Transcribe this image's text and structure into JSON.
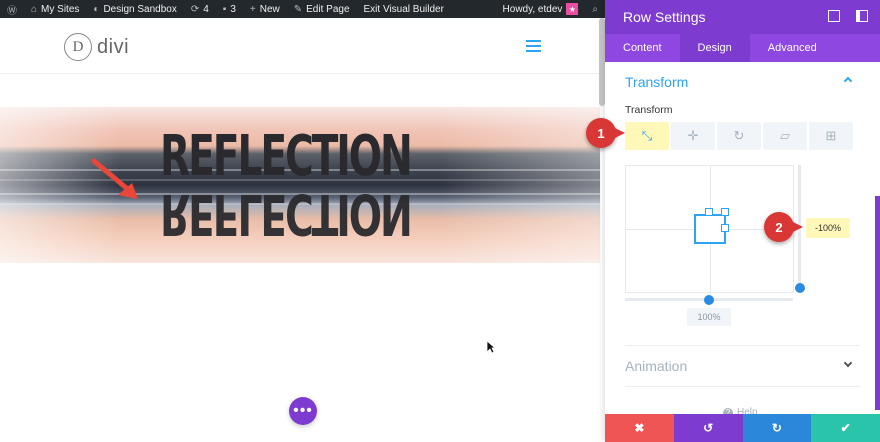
{
  "adminbar": {
    "my_sites": "My Sites",
    "site_name": "Design Sandbox",
    "updates_count": "4",
    "comments_count": "3",
    "new_label": "New",
    "edit_page": "Edit Page",
    "exit_builder": "Exit Visual Builder",
    "greeting": "Howdy, etdev"
  },
  "site": {
    "logo_letter": "D",
    "logo_text": "divi"
  },
  "hero": {
    "title": "REFLECTION"
  },
  "panel": {
    "title": "Row Settings",
    "tabs": [
      {
        "label": "Content"
      },
      {
        "label": "Design"
      },
      {
        "label": "Advanced"
      }
    ],
    "active_tab": "Design",
    "section_title": "Transform",
    "sub_label": "Transform",
    "tools": [
      {
        "name": "scale",
        "glyph": "⤡"
      },
      {
        "name": "translate",
        "glyph": "✛"
      },
      {
        "name": "rotate",
        "glyph": "↻"
      },
      {
        "name": "skew",
        "glyph": "▱"
      },
      {
        "name": "origin",
        "glyph": "⊞"
      }
    ],
    "scale_x_value": "100%",
    "scale_y_value": "-100%",
    "animation_title": "Animation",
    "help_label": "Help"
  },
  "callouts": [
    "1",
    "2"
  ],
  "footer": {
    "cancel": "✖",
    "undo": "↺",
    "redo": "↻",
    "save": "✔"
  },
  "colors": {
    "purple": "#7e3bd0",
    "blue": "#2ea3f2",
    "cancel": "#ef5555",
    "undo": "#7e3bd0",
    "redo": "#2b87da",
    "save": "#29c4a9",
    "callout": "#d93636"
  }
}
